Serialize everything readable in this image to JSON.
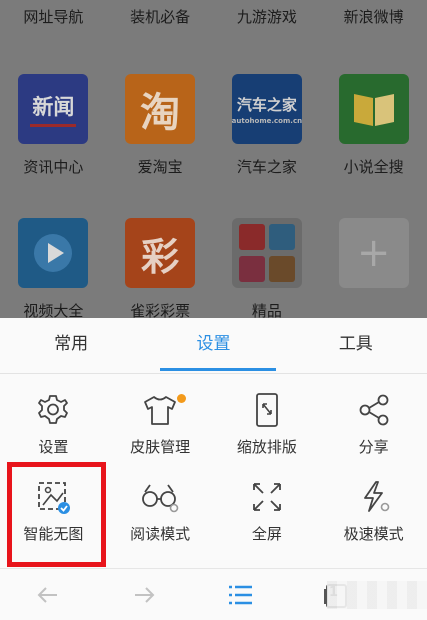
{
  "home": {
    "top_labels": [
      "网址导航",
      "装机必备",
      "九游游戏",
      "新浪微博"
    ],
    "row1": [
      {
        "label": "资讯中心",
        "icon": "news-icon",
        "glyph": "新闻",
        "color": "#2c3a82"
      },
      {
        "label": "爱淘宝",
        "icon": "taobao-icon",
        "glyph": "淘",
        "color": "#b86419"
      },
      {
        "label": "汽车之家",
        "icon": "autohome-icon",
        "glyph": "汽车之家",
        "sub": "autohome.com.cn",
        "color": "#173e74"
      },
      {
        "label": "小说全搜",
        "icon": "book-icon",
        "glyph": "",
        "color": "#286a2e"
      }
    ],
    "row2": [
      {
        "label": "视频大全",
        "icon": "video-play-icon",
        "color": "#1f5a86"
      },
      {
        "label": "雀彩彩票",
        "icon": "lottery-icon",
        "glyph": "彩",
        "color": "#a5441a"
      },
      {
        "label": "精品",
        "icon": "apps-collection-icon",
        "color": "#6b6b6b"
      },
      {
        "label": "",
        "icon": "add-icon",
        "glyph": "+",
        "color": "#8a8a8a"
      }
    ]
  },
  "tabs": [
    "常用",
    "设置",
    "工具"
  ],
  "active_tab": "设置",
  "accent": "#2b8fe3",
  "tools_row1": [
    {
      "label": "设置",
      "icon": "settings-gear-icon"
    },
    {
      "label": "皮肤管理",
      "icon": "tshirt-skin-icon"
    },
    {
      "label": "缩放排版",
      "icon": "zoom-layout-icon"
    },
    {
      "label": "分享",
      "icon": "share-icon"
    }
  ],
  "tools_row2": [
    {
      "label": "智能无图",
      "icon": "smart-no-image-icon"
    },
    {
      "label": "阅读模式",
      "icon": "reading-glasses-icon"
    },
    {
      "label": "全屏",
      "icon": "fullscreen-icon"
    },
    {
      "label": "极速模式",
      "icon": "lightning-icon"
    }
  ],
  "bottom_bar": {
    "icons": [
      "back-arrow-icon",
      "forward-arrow-icon",
      "menu-icon",
      "window-icon"
    ],
    "window_count": "1"
  },
  "highlight_color": "#e8141b",
  "badge_color": "#f39a1b"
}
